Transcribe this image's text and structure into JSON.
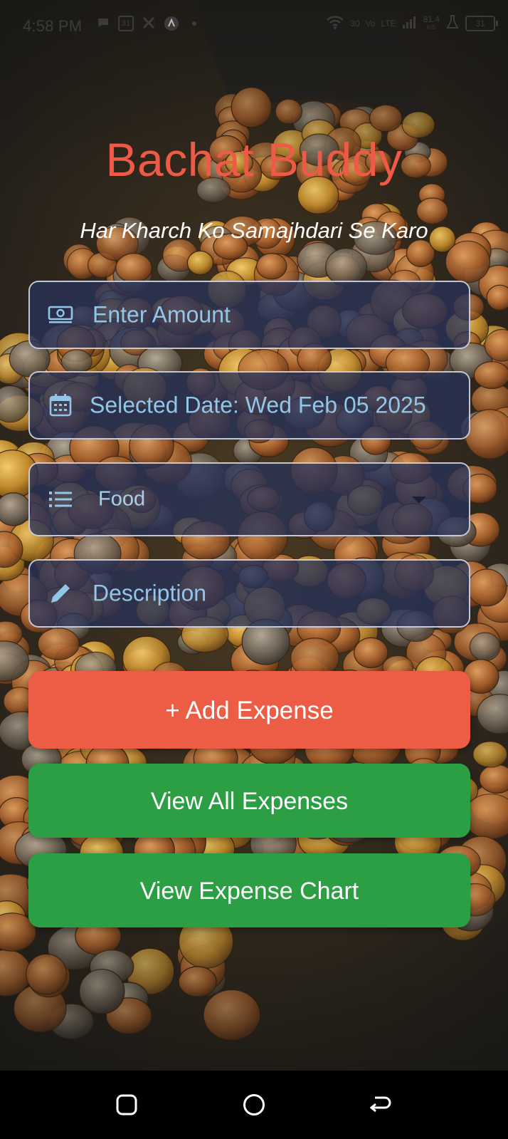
{
  "status_bar": {
    "time": "4:58 PM",
    "notification_icons": [
      "chat-bubble-icon",
      "calendar-31-icon",
      "x-logo-icon",
      "avast-icon",
      "dot-icon"
    ],
    "calendar_day": "31",
    "network_speed": "81.4",
    "network_speed_unit": "K/S",
    "network_labels": [
      "30",
      "Vo",
      "LTE",
      "LTE"
    ],
    "battery_level": "31"
  },
  "app": {
    "title": "Bachat Buddy",
    "tagline": "Har Kharch Ko Samajhdari Se Karo"
  },
  "form": {
    "amount": {
      "placeholder": "Enter Amount",
      "icon": "money-bill-icon"
    },
    "date": {
      "value": "Selected Date: Wed Feb 05 2025",
      "icon": "calendar-icon"
    },
    "category": {
      "selected": "Food",
      "icon": "list-icon"
    },
    "description": {
      "placeholder": "Description",
      "icon": "pencil-icon"
    }
  },
  "buttons": {
    "add_expense": "+ Add Expense",
    "view_all": "View All Expenses",
    "view_chart": "View Expense Chart"
  },
  "colors": {
    "title": "#ee5a45",
    "add_button": "#ed5d45",
    "green_buttons": "#2c9e43",
    "field_text": "#93c6e6",
    "field_bg": "#283258"
  },
  "nav_bar": {
    "items": [
      "recent-apps-icon",
      "home-icon",
      "back-icon"
    ]
  }
}
